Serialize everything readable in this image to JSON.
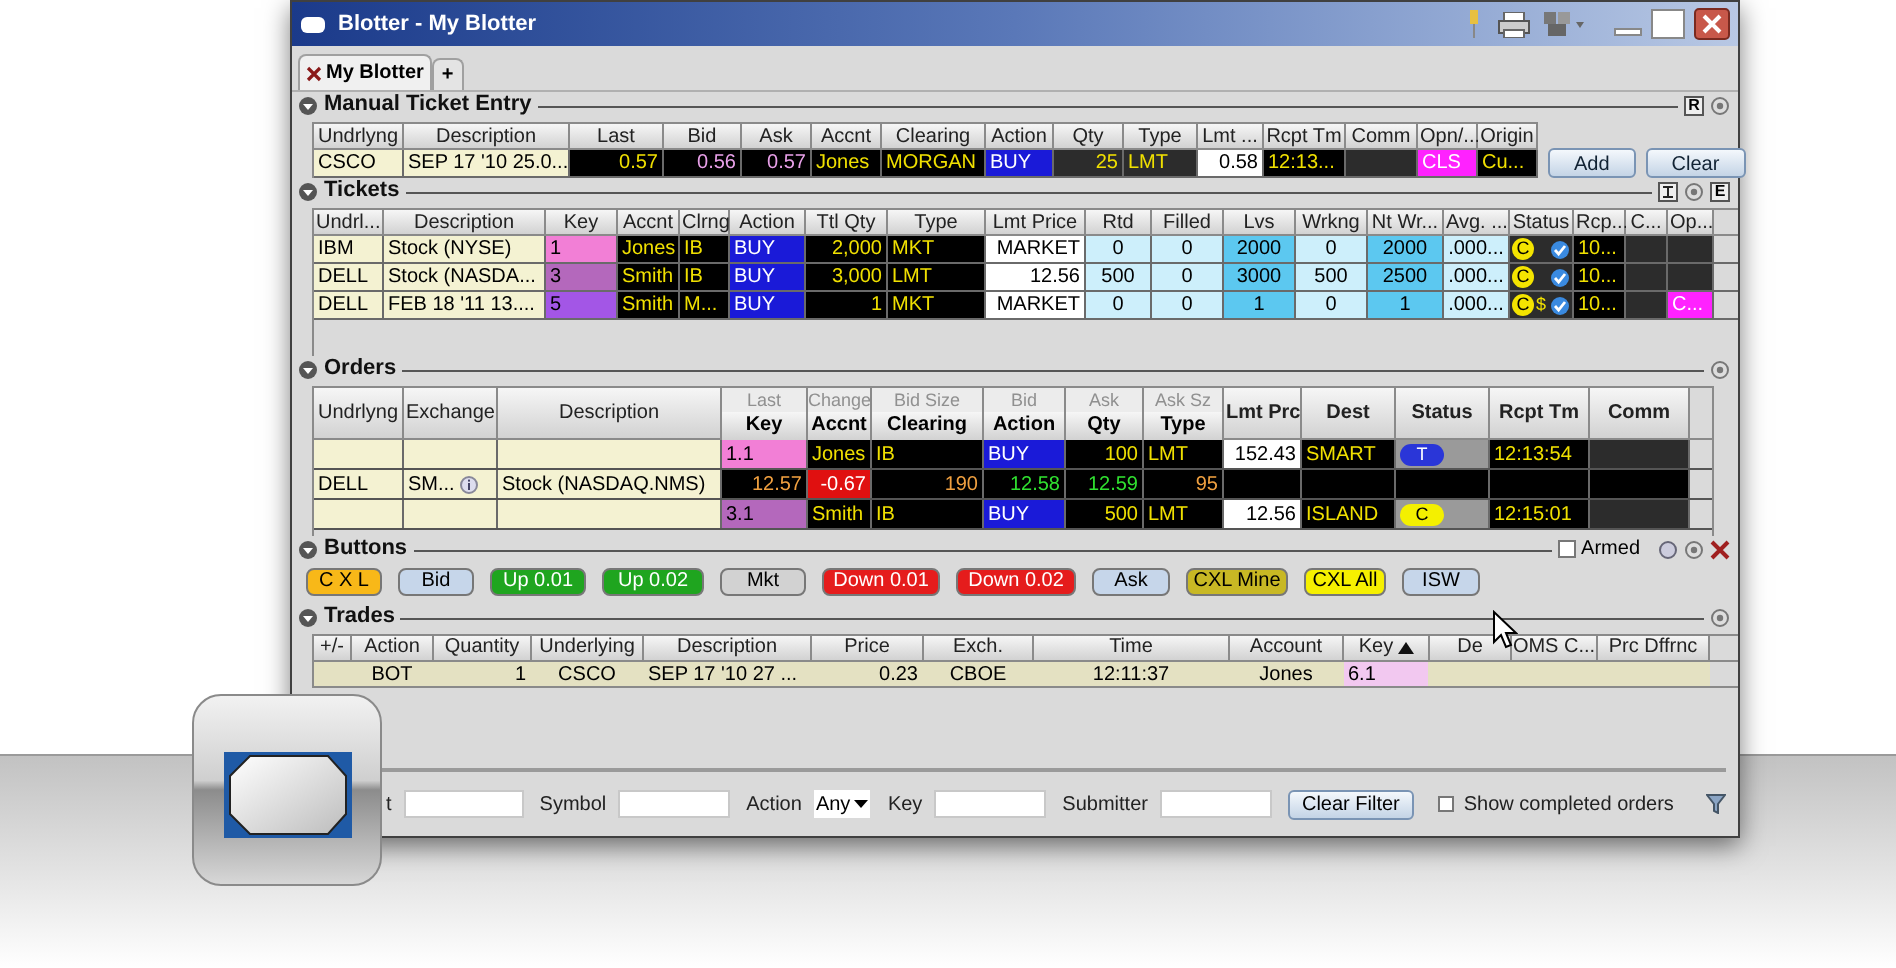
{
  "window": {
    "title": "Blotter - My Blotter"
  },
  "tabs": [
    {
      "label": "My Blotter",
      "selected": true
    },
    {
      "label": "+",
      "selected": false
    }
  ],
  "manual_ticket_entry": {
    "title": "Manual Ticket Entry",
    "badges": [
      "R"
    ],
    "columns": [
      "Undrlyng",
      "Description",
      "Last",
      "Bid",
      "Ask",
      "Accnt",
      "Clearing",
      "Action",
      "Qty",
      "Type",
      "Lmt ...",
      "Rcpt Tm",
      "Comm",
      "Opn/...",
      "Origin"
    ],
    "rows": [
      [
        "CSCO",
        "SEP 17 '10 25.0...",
        "0.57",
        "0.56",
        "0.57",
        "Jones",
        "MORGAN",
        "BUY",
        "25",
        "LMT",
        "0.58",
        "12:13...",
        null,
        "CLS",
        "Cu..."
      ]
    ],
    "buttons": [
      "Add",
      "Clear"
    ]
  },
  "tickets": {
    "title": "Tickets",
    "badges": [
      "E"
    ],
    "columns": [
      "Undrl...",
      "Description",
      "Key",
      "Accnt",
      "Clrng",
      "Action",
      "Ttl Qty",
      "Type",
      "Lmt Price",
      "Rtd",
      "Filled",
      "Lvs",
      "Wrkng",
      "Nt Wr...",
      "Avg. ...",
      "Status",
      "Rcp...",
      "C...",
      "Op..."
    ],
    "rows": [
      {
        "color": "#f27fd6",
        "status": {
          "text": "C"
        },
        "cells": [
          "IBM",
          "Stock (NYSE)",
          "1",
          "Jones",
          "IB",
          "BUY",
          "2,000",
          "MKT",
          "MARKET",
          "0",
          "0",
          "2000",
          "0",
          "2000",
          ".000...",
          null,
          "10...",
          null,
          null
        ]
      },
      {
        "color": "#b468bc",
        "status": {
          "text": "C"
        },
        "cells": [
          "DELL",
          "Stock (NASDA...",
          "3",
          "Smith",
          "IB",
          "BUY",
          "3,000",
          "LMT",
          "12.56",
          "500",
          "0",
          "3000",
          "500",
          "2500",
          ".000...",
          null,
          "10...",
          null,
          null
        ]
      },
      {
        "color": "#a356e6",
        "status": {
          "text": "C",
          "extra": "$"
        },
        "cells": [
          "DELL",
          "FEB 18 '11 13....",
          "5",
          "Smith",
          "M...",
          "BUY",
          "1",
          "MKT",
          "MARKET",
          "0",
          "0",
          "1",
          "0",
          "1",
          ".000...",
          null,
          "10...",
          null,
          "C..."
        ]
      }
    ]
  },
  "orders": {
    "title": "Orders",
    "columns": [
      {
        "label": "Undrlyng"
      },
      {
        "label": "Exchange"
      },
      {
        "label": "Description"
      },
      {
        "top": "Last",
        "label": "Key"
      },
      {
        "top": "Change",
        "label": "Accnt"
      },
      {
        "top": "Bid Size",
        "label": "Clearing"
      },
      {
        "top": "Bid",
        "label": "Action"
      },
      {
        "top": "Ask",
        "label": "Qty"
      },
      {
        "top": "Ask Sz",
        "label": "Type"
      },
      {
        "label": "Lmt Prc"
      },
      {
        "label": "Dest"
      },
      {
        "label": "Status"
      },
      {
        "label": "Rcpt Tm"
      },
      {
        "label": "Comm"
      }
    ],
    "rows": [
      {
        "kind": "order",
        "color": "#f27fd6",
        "status": {
          "text": "T",
          "color": "#2a36d8"
        },
        "cells": [
          null,
          null,
          null,
          "1.1",
          "Jones",
          "IB",
          "BUY",
          "100",
          "LMT",
          "152.43",
          "SMART",
          null,
          "12:13:54",
          null
        ]
      },
      {
        "kind": "market",
        "cells": [
          "DELL",
          "SM...",
          "Stock (NASDAQ.NMS)",
          "12.57",
          "-0.67",
          "190",
          "12.58",
          "12.59",
          "95",
          null,
          null,
          null,
          null,
          null
        ]
      },
      {
        "kind": "order",
        "color": "#b468bc",
        "status": {
          "text": "C",
          "color": "#f4f000"
        },
        "cells": [
          null,
          null,
          null,
          "3.1",
          "Smith",
          "IB",
          "BUY",
          "500",
          "LMT",
          "12.56",
          "ISLAND",
          null,
          "12:15:01",
          null
        ]
      }
    ]
  },
  "buttons_panel": {
    "title": "Buttons",
    "armed": {
      "label": "Armed",
      "checked": false
    },
    "buttons": [
      {
        "label": "C X L",
        "color": "#f8b818"
      },
      {
        "label": "Bid",
        "color": "#c6d6ea"
      },
      {
        "label": "Up 0.01",
        "color": "#1fa51f"
      },
      {
        "label": "Up 0.02",
        "color": "#1fa51f"
      },
      {
        "label": "Mkt",
        "color": "#d2d2d2"
      },
      {
        "label": "Down 0.01",
        "color": "#e51c1c"
      },
      {
        "label": "Down 0.02",
        "color": "#e51c1c"
      },
      {
        "label": "Ask",
        "color": "#c6d6ea"
      },
      {
        "label": "CXL Mine",
        "color": "#c8b824"
      },
      {
        "label": "CXL All",
        "color": "#f6f000"
      },
      {
        "label": "ISW",
        "color": "#c6d6ea"
      }
    ]
  },
  "trades": {
    "title": "Trades",
    "columns": [
      {
        "label": "+/-",
        "sorted": false
      },
      {
        "label": "Action",
        "sorted": false
      },
      {
        "label": "Quantity",
        "sorted": false
      },
      {
        "label": "Underlying",
        "sorted": false
      },
      {
        "label": "Description",
        "sorted": false
      },
      {
        "label": "Price",
        "sorted": false
      },
      {
        "label": "Exch.",
        "sorted": false
      },
      {
        "label": "Time",
        "sorted": false
      },
      {
        "label": "Account",
        "sorted": false
      },
      {
        "label": "Key",
        "sorted": true
      },
      {
        "label": "De",
        "sorted": false
      },
      {
        "label": "OMS C...",
        "sorted": false
      },
      {
        "label": "Prc Dffrnc",
        "sorted": false
      }
    ],
    "rows": [
      {
        "color": "#f2c8f0",
        "cells": [
          null,
          "BOT",
          "1",
          "CSCO",
          "SEP 17 '10 27 ...",
          "0.23",
          "CBOE",
          "12:11:37",
          "Jones",
          "6.1",
          null,
          null,
          null
        ]
      }
    ]
  },
  "filter": {
    "fields": [
      {
        "label": "t",
        "kind": "text"
      },
      {
        "label": "Symbol",
        "kind": "text"
      },
      {
        "label": "Action",
        "kind": "select",
        "value": "Any"
      },
      {
        "label": "Key",
        "kind": "text"
      },
      {
        "label": "Submitter",
        "kind": "text"
      }
    ],
    "button": "Clear Filter",
    "checkbox": {
      "label": "Show completed orders",
      "checked": false
    }
  }
}
